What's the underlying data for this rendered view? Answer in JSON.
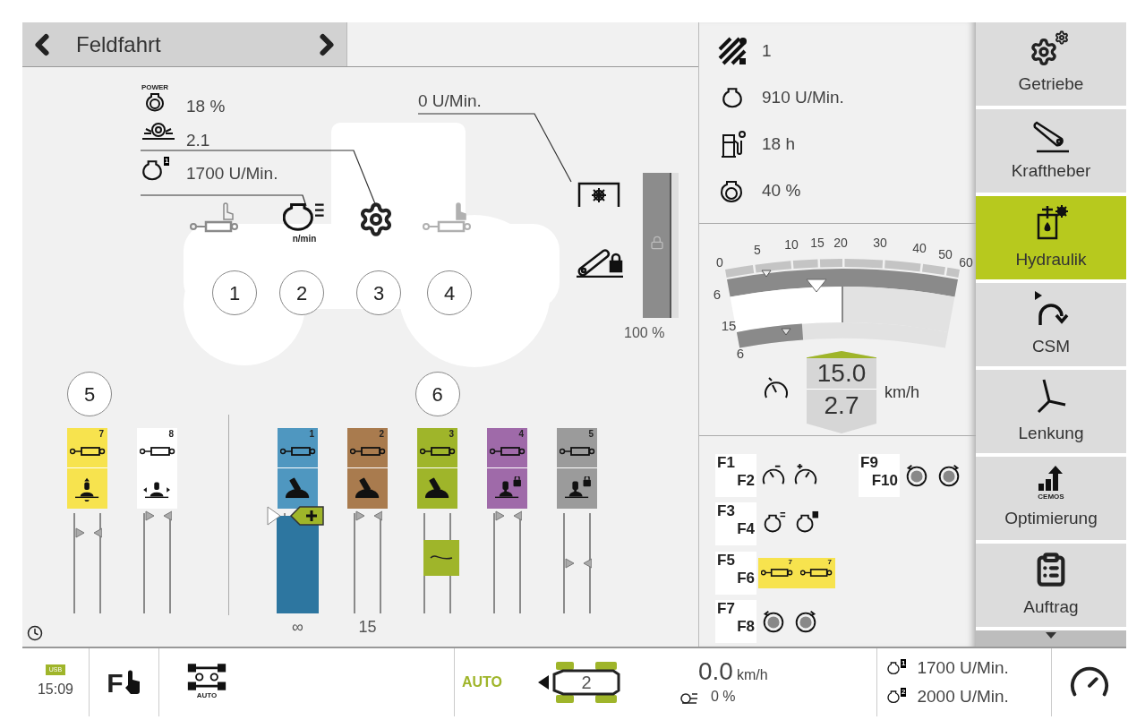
{
  "header": {
    "title": "Feldfahrt"
  },
  "tractor": {
    "readouts": [
      {
        "kind": "power",
        "badge": "POWER",
        "value": "18 %"
      },
      {
        "kind": "bale",
        "value": "2.1"
      },
      {
        "kind": "engine",
        "badge": "1",
        "value": "1700 U/Min."
      }
    ],
    "pto_speed": "0 U/Min.",
    "functions": [
      {
        "number": "1",
        "kind": "cylinder"
      },
      {
        "number": "2",
        "kind": "engine",
        "sub": "n/min"
      },
      {
        "number": "3",
        "kind": "gear"
      },
      {
        "number": "4",
        "kind": "cylinder-dim"
      }
    ],
    "lift": {
      "level": 1,
      "reading": "100 %"
    }
  },
  "valve_groups": [
    {
      "label": "5",
      "valves": [
        {
          "number": "7",
          "color": "#f7e34e",
          "lever": {
            "kind": "vertical",
            "locked": false
          },
          "track": {
            "kind": "marker",
            "level": 0.8
          }
        },
        {
          "number": "8",
          "color": "#ffffff",
          "lever": {
            "kind": "horizontal",
            "locked": false
          },
          "track": {
            "kind": "marker",
            "level": 0.97
          }
        }
      ]
    },
    {
      "label": "6",
      "valves": [
        {
          "number": "1",
          "color": "#4f97c0",
          "lever": {
            "kind": "tilted",
            "locked": false
          },
          "track": {
            "kind": "fill",
            "level": 0.97
          },
          "footer": "∞"
        },
        {
          "number": "2",
          "color": "#a97b4e",
          "lever": {
            "kind": "tilted",
            "locked": false
          },
          "track": {
            "kind": "marker",
            "level": 0.97
          },
          "footer": "15"
        },
        {
          "number": "3",
          "color": "#9fb52a",
          "lever": {
            "kind": "tilted",
            "locked": false
          },
          "track": {
            "kind": "float"
          }
        },
        {
          "number": "4",
          "color": "#9f6aa9",
          "lever": {
            "kind": "upright",
            "locked": true
          },
          "track": {
            "kind": "marker",
            "level": 0.97
          }
        },
        {
          "number": "5",
          "color": "#9b9b9b",
          "lever": {
            "kind": "upright",
            "locked": true
          },
          "track": {
            "kind": "marker",
            "level": 0.5
          }
        }
      ]
    }
  ],
  "info": [
    {
      "kind": "ballast",
      "value": "1"
    },
    {
      "kind": "engine",
      "value": "910 U/Min."
    },
    {
      "kind": "fuel",
      "value": "18 h"
    },
    {
      "kind": "power",
      "value": "40 %"
    }
  ],
  "speed_gauge": {
    "scale_labels": [
      "0",
      "5",
      "10",
      "15",
      "20",
      "30",
      "40",
      "50",
      "60"
    ],
    "side_labels": [
      "6",
      "15",
      "6"
    ],
    "set_speed": "15.0",
    "actual_speed": "2.7",
    "unit": "km/h"
  },
  "function_keys": [
    {
      "keys": [
        "F1",
        "F2"
      ],
      "icons": [
        {
          "kind": "speed-minus"
        },
        {
          "kind": "speed-plus"
        }
      ],
      "highlighted": false
    },
    {
      "keys": [
        "F3",
        "F4"
      ],
      "icons": [
        {
          "kind": "power-list"
        },
        {
          "kind": "engine-two"
        }
      ],
      "highlighted": false
    },
    {
      "keys": [
        "F5",
        "F6"
      ],
      "icons": [
        {
          "kind": "cylinder-float",
          "label": "7"
        },
        {
          "kind": "cylinder-return",
          "label": "7"
        }
      ],
      "highlighted": true
    },
    {
      "keys": [
        "F7",
        "F8"
      ],
      "icons": [
        {
          "kind": "reel-ccw"
        },
        {
          "kind": "reel-cw"
        }
      ],
      "highlighted": false
    },
    {
      "keys": [
        "F9",
        "F10"
      ],
      "icons": [
        {
          "kind": "reel-ccw"
        },
        {
          "kind": "reel-cw"
        }
      ],
      "highlighted": false
    }
  ],
  "sidebar": [
    {
      "label": "Getriebe",
      "kind": "gears",
      "selected": false
    },
    {
      "label": "Kraftheber",
      "kind": "lift",
      "selected": false
    },
    {
      "label": "Hydraulik",
      "kind": "hydraulic",
      "selected": true
    },
    {
      "label": "CSM",
      "kind": "csm",
      "selected": false
    },
    {
      "label": "Lenkung",
      "kind": "steering",
      "selected": false
    },
    {
      "label": "Optimierung",
      "kind": "cemos",
      "badge": "CEMOS",
      "selected": false
    },
    {
      "label": "Auftrag",
      "kind": "clipboard",
      "selected": false
    }
  ],
  "status_bar": {
    "usb": "USB",
    "time": "15:09",
    "fn_label": "F",
    "drive_label": "AUTO",
    "steering_mode": "AUTO",
    "steering_program": "2",
    "speed": "0.0",
    "speed_unit": "km/h",
    "slip": "0 %",
    "rpm": [
      {
        "badge": "1",
        "value": "1700 U/Min."
      },
      {
        "badge": "2",
        "value": "2000 U/Min."
      }
    ]
  }
}
